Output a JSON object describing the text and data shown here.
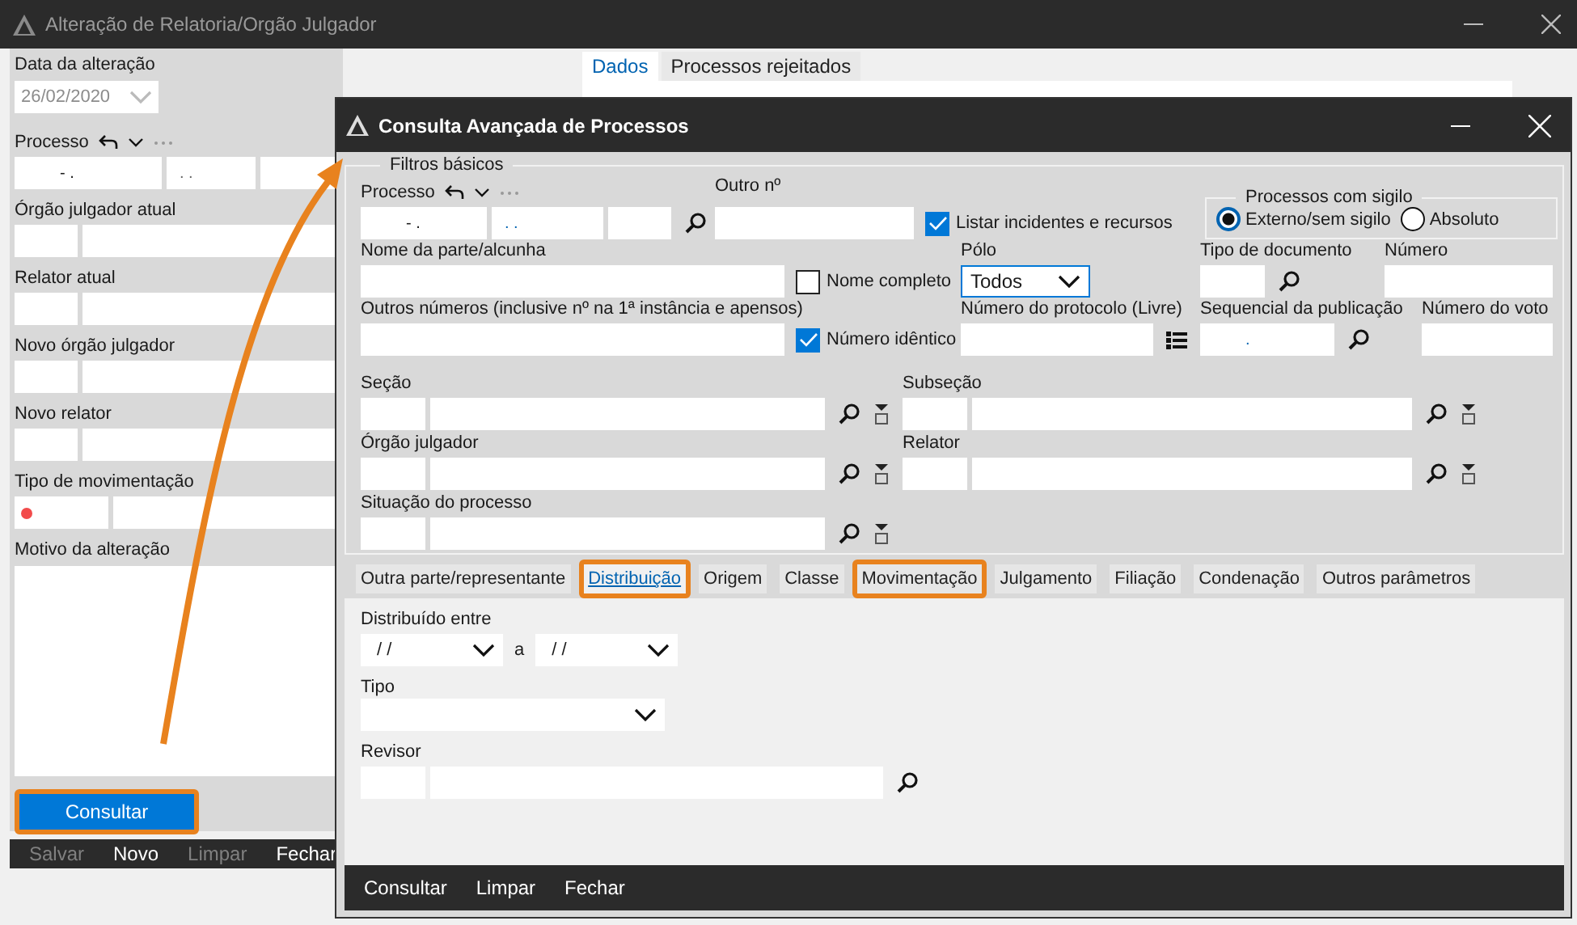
{
  "main_window": {
    "title": "Alteração de Relatoria/Orgão Julgador",
    "date": {
      "label": "Data da alteração",
      "value": "26/02/2020",
      "disabled": true
    },
    "processo": {
      "label": "Processo",
      "values": [
        "- .",
        ". ."
      ]
    },
    "pair_fields": [
      {
        "label": "Órgão julgador atual"
      },
      {
        "label": "Relator atual"
      },
      {
        "label": "Novo órgão julgador"
      },
      {
        "label": "Novo relator"
      },
      {
        "label": "Tipo de movimentação",
        "required": true
      }
    ],
    "motivo": {
      "label": "Motivo da alteração"
    },
    "consult_button": {
      "label": "Consultar",
      "highlighted": true
    },
    "toolbar": [
      {
        "label": "Salvar",
        "disabled": true
      },
      {
        "label": "Novo",
        "disabled": false
      },
      {
        "label": "Limpar",
        "disabled": true
      },
      {
        "label": "Fechar",
        "disabled": false
      }
    ],
    "tabs": [
      {
        "label": "Dados",
        "selected": true
      },
      {
        "label": "Processos rejeitados",
        "selected": false
      }
    ]
  },
  "dialog": {
    "title": "Consulta Avançada de Processos",
    "legend": "Filtros básicos",
    "processo": {
      "label": "Processo",
      "values": [
        "- .",
        ". ."
      ]
    },
    "outro_numero": {
      "label": "Outro nº"
    },
    "listar_incidentes": {
      "label": "Listar incidentes e recursos",
      "checked": true
    },
    "sigilo": {
      "legend": "Processos com sigilo",
      "options": [
        {
          "label": "Externo/sem sigilo",
          "selected": true
        },
        {
          "label": "Absoluto",
          "selected": false
        }
      ]
    },
    "nome_parte": {
      "label": "Nome da parte/alcunha"
    },
    "nome_completo": {
      "label": "Nome completo",
      "checked": false
    },
    "polo": {
      "label": "Pólo",
      "value": "Todos"
    },
    "tipo_documento": {
      "label": "Tipo de documento"
    },
    "numero": {
      "label": "Número"
    },
    "outros_numeros": {
      "label": "Outros números  (inclusive nº na 1ª instância e apensos)"
    },
    "numero_identico": {
      "label": "Número idêntico",
      "checked": true
    },
    "numero_protocolo": {
      "label": "Número do protocolo (Livre)"
    },
    "sequencial": {
      "label": "Sequencial da publicação",
      "value": "."
    },
    "numero_voto": {
      "label": "Número do voto"
    },
    "lookups": [
      {
        "label": "Seção"
      },
      {
        "label": "Subseção"
      },
      {
        "label": "Órgão julgador"
      },
      {
        "label": "Relator"
      },
      {
        "label": "Situação do processo"
      }
    ],
    "tabs": [
      {
        "label": "Outra parte/representante",
        "selected": false,
        "highlighted": false
      },
      {
        "label": "Distribuição",
        "selected": true,
        "highlighted": true
      },
      {
        "label": "Origem",
        "selected": false,
        "highlighted": false
      },
      {
        "label": "Classe",
        "selected": false,
        "highlighted": false
      },
      {
        "label": "Movimentação",
        "selected": false,
        "highlighted": true
      },
      {
        "label": "Julgamento",
        "selected": false,
        "highlighted": false
      },
      {
        "label": "Filiação",
        "selected": false,
        "highlighted": false
      },
      {
        "label": "Condenação",
        "selected": false,
        "highlighted": false
      },
      {
        "label": "Outros parâmetros",
        "selected": false,
        "highlighted": false
      }
    ],
    "distribuido": {
      "label": "Distribuído entre",
      "from": "/ /",
      "separator": "a",
      "to": "/ /"
    },
    "tipo": {
      "label": "Tipo"
    },
    "revisor": {
      "label": "Revisor"
    },
    "buttons": [
      "Consultar",
      "Limpar",
      "Fechar"
    ]
  }
}
